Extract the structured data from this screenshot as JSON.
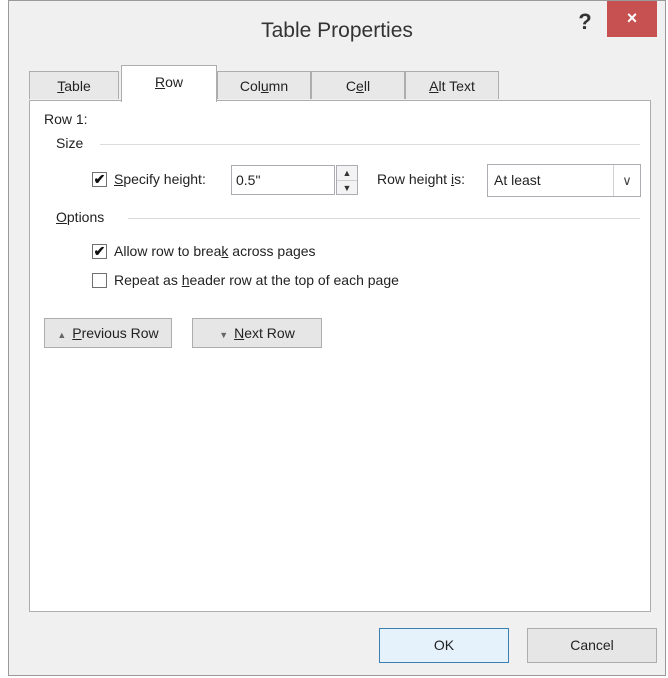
{
  "window": {
    "title": "Table Properties",
    "help": "?",
    "close": "×"
  },
  "tabs": [
    {
      "pre": "",
      "u": "T",
      "post": "able"
    },
    {
      "pre": "",
      "u": "R",
      "post": "ow"
    },
    {
      "pre": "Col",
      "u": "u",
      "post": "mn"
    },
    {
      "pre": "C",
      "u": "e",
      "post": "ll"
    },
    {
      "pre": "",
      "u": "A",
      "post": "lt Text"
    }
  ],
  "active_tab": "Row",
  "row": {
    "heading": "Row 1:",
    "size_label": "Size",
    "specify_height": {
      "pre": "",
      "u": "S",
      "post": "pecify height:",
      "checked": true
    },
    "height_value": "0.5\"",
    "row_height_is": {
      "pre": "Row height ",
      "u": "i",
      "post": "s:"
    },
    "height_rule": "At least",
    "options_label": {
      "pre": "",
      "u": "O",
      "post": "ptions"
    },
    "allow_break": {
      "pre": "Allow row to brea",
      "u": "k",
      "post": " across pages",
      "checked": true
    },
    "repeat_header": {
      "pre": "Repeat as ",
      "u": "h",
      "post": "eader row at the top of each page",
      "checked": false
    }
  },
  "nav": {
    "previous": {
      "icon": "▲",
      "pre": "",
      "u": "P",
      "post": "revious Row"
    },
    "next": {
      "icon": "▼",
      "pre": "",
      "u": "N",
      "post": "ext Row"
    }
  },
  "footer": {
    "ok": "OK",
    "cancel": "Cancel"
  }
}
